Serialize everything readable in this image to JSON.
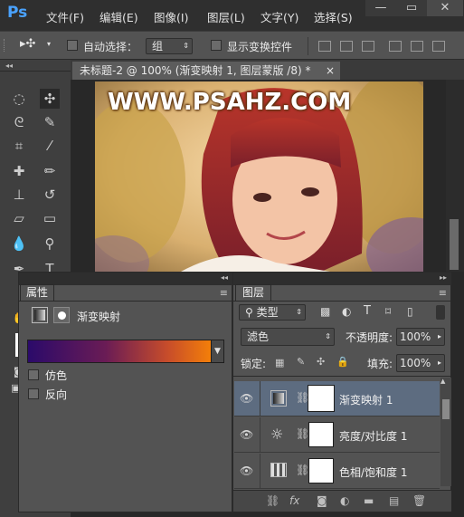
{
  "app": {
    "logo": "Ps"
  },
  "menu": [
    "文件(F)",
    "编辑(E)",
    "图像(I)",
    "图层(L)",
    "文字(Y)",
    "选择(S)"
  ],
  "window_controls": {
    "minimize": "—",
    "restore": "▭",
    "close": "✕"
  },
  "options_bar": {
    "tool_glyph": "▸✣",
    "auto_select_label": "自动选择：",
    "auto_select_value": "组",
    "show_transform_label": "显示变换控件"
  },
  "document": {
    "tab_title": "未标题-2 @ 100% (渐变映射 1, 图层蒙版 /8) *",
    "tab_close": "×"
  },
  "photo": {
    "watermark": "WWW.PSAHZ.COM"
  },
  "properties_panel": {
    "tab": "属性",
    "collapse": "◂◂",
    "menu": "≡",
    "title": "渐变映射",
    "gradient_colors": [
      "#2b0a6a",
      "#6a1c55",
      "#c84d2a",
      "#ff8c00"
    ],
    "dither_label": "仿色",
    "dither_checked": false,
    "reverse_label": "反向",
    "reverse_checked": false
  },
  "layers_panel": {
    "tab": "图层",
    "collapse": "▸▸",
    "menu": "≡",
    "filter_label": "类型",
    "blend_mode": "滤色",
    "opacity_label": "不透明度:",
    "opacity_value": "100%",
    "lock_label": "锁定:",
    "fill_label": "填充:",
    "fill_value": "100%",
    "layers": [
      {
        "name": "渐变映射 1",
        "selected": true
      },
      {
        "name": "亮度/对比度 1",
        "selected": false
      },
      {
        "name": "色相/饱和度 1",
        "selected": false
      }
    ]
  },
  "colors": {
    "accent_blue": "#4aa3ff",
    "selected_layer": "#5d6c80"
  }
}
